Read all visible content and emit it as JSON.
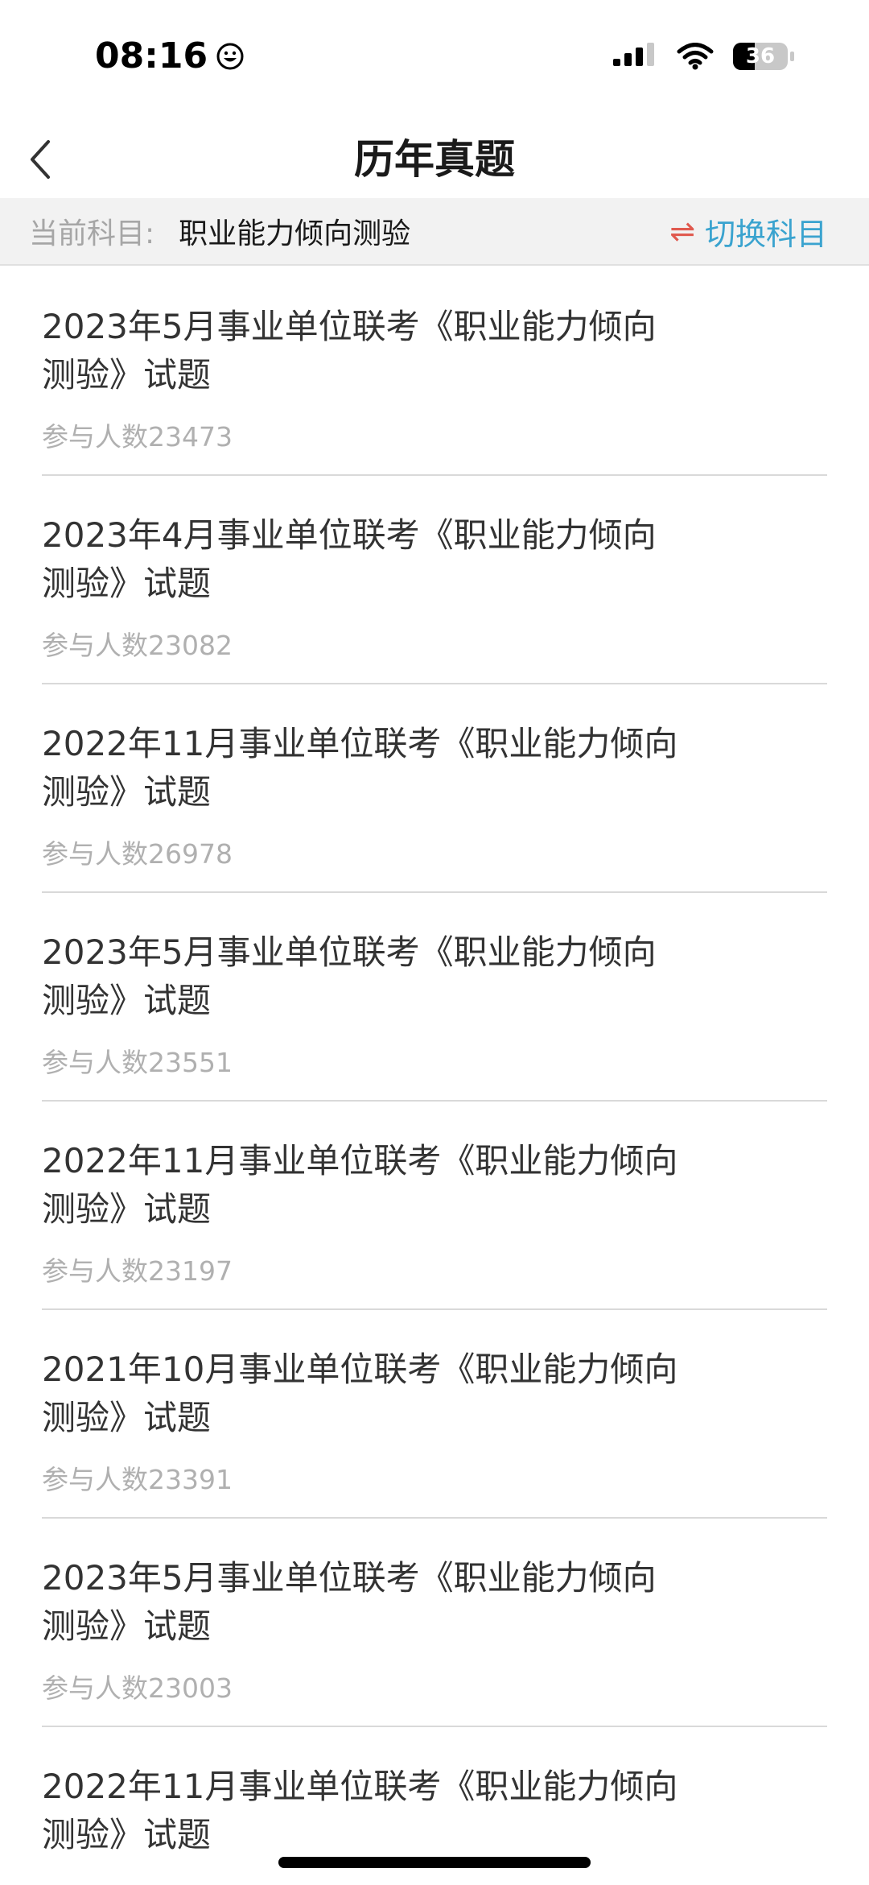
{
  "status_bar": {
    "time": "08:16",
    "battery_level": "36"
  },
  "nav": {
    "title": "历年真题"
  },
  "subject_bar": {
    "label": "当前科目:",
    "value": "职业能力倾向测验",
    "switch_icon": "⇌",
    "switch_label": "切换科目"
  },
  "papers": [
    {
      "title": "2023年5月事业单位联考《职业能力倾向测验》试题",
      "count": "参与人数23473"
    },
    {
      "title": "2023年4月事业单位联考《职业能力倾向测验》试题",
      "count": "参与人数23082"
    },
    {
      "title": "2022年11月事业单位联考《职业能力倾向测验》试题",
      "count": "参与人数26978"
    },
    {
      "title": "2023年5月事业单位联考《职业能力倾向测验》试题",
      "count": "参与人数23551"
    },
    {
      "title": "2022年11月事业单位联考《职业能力倾向测验》试题",
      "count": "参与人数23197"
    },
    {
      "title": "2021年10月事业单位联考《职业能力倾向测验》试题",
      "count": "参与人数23391"
    },
    {
      "title": "2023年5月事业单位联考《职业能力倾向测验》试题",
      "count": "参与人数23003"
    },
    {
      "title": "2022年11月事业单位联考《职业能力倾向测验》试题",
      "count": ""
    }
  ],
  "colors": {
    "accent": "#3aa3cf",
    "switch_icon": "#e05a4f",
    "subject_bg": "#f2f2f2"
  }
}
